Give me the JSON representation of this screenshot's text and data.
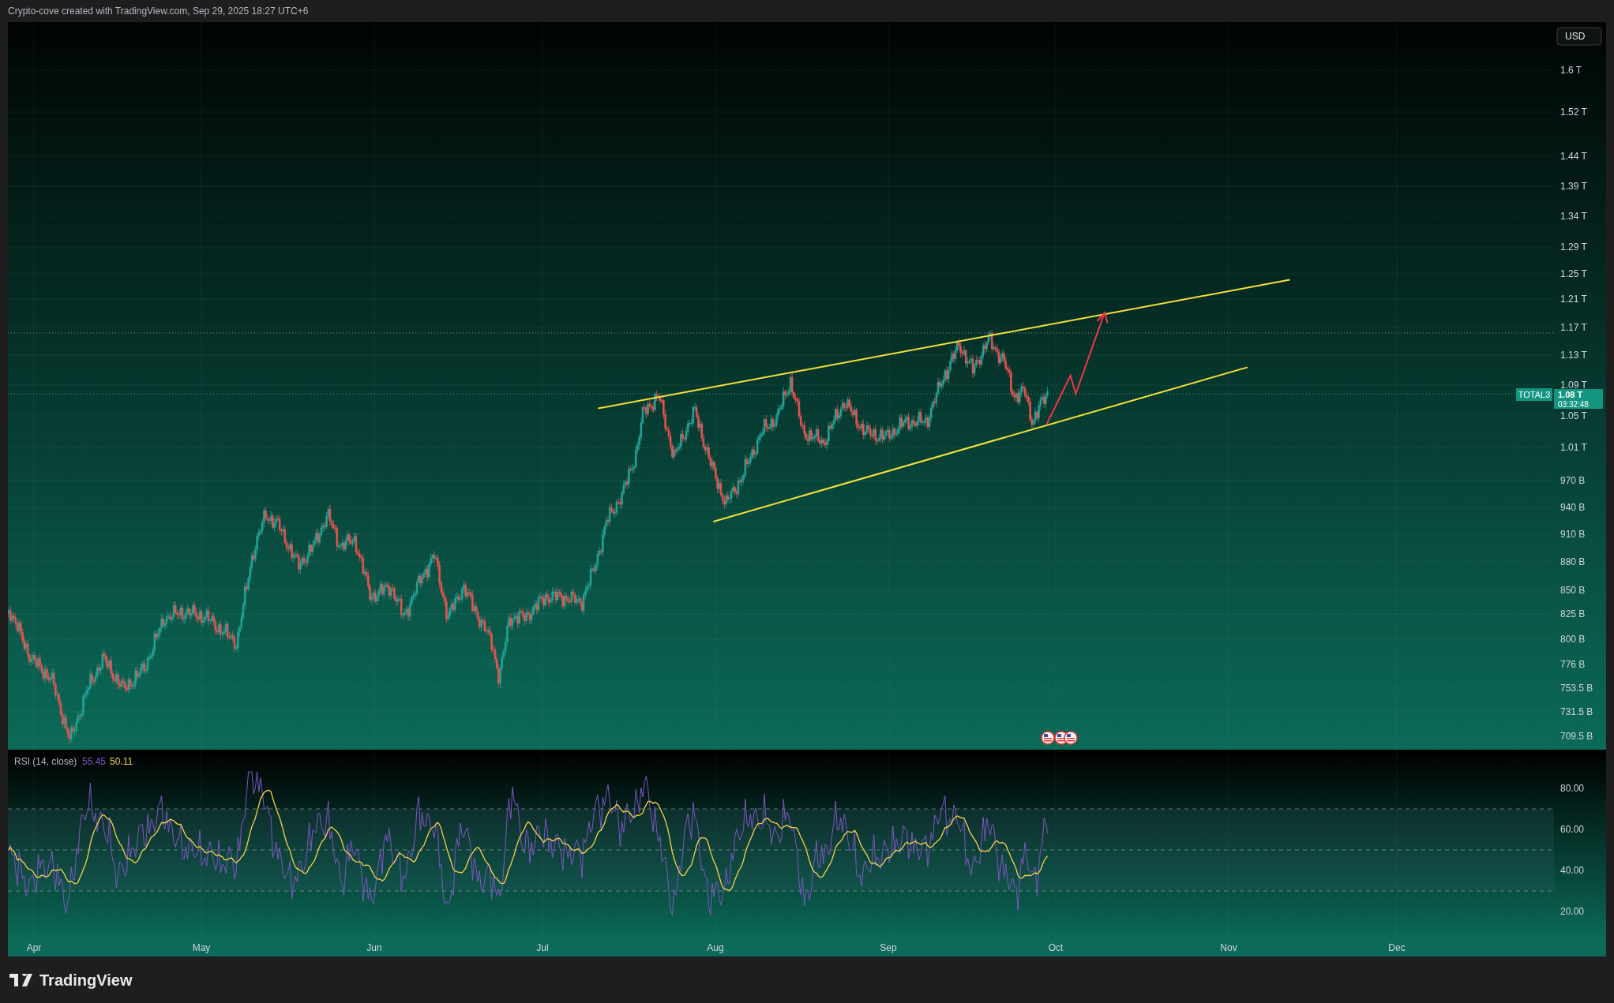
{
  "header": {
    "text": "Crypto-cove created with TradingView.com, Sep 29, 2025 18:27 UTC+6"
  },
  "price_axis": {
    "currency_button": "USD",
    "labels": [
      "1.6 T",
      "1.52 T",
      "1.44 T",
      "1.39 T",
      "1.34 T",
      "1.29 T",
      "1.25 T",
      "1.21 T",
      "1.17 T",
      "1.13 T",
      "1.09 T",
      "1.05 T",
      "1.01 T",
      "970 B",
      "940 B",
      "910 B",
      "880 B",
      "850 B",
      "825 B",
      "800 B",
      "776 B",
      "753.5 B",
      "731.5 B",
      "709.5 B"
    ]
  },
  "symbol_label": {
    "symbol": "TOTAL3",
    "price": "1.08 T",
    "countdown": "03:32:48"
  },
  "rsi": {
    "title": "RSI (14, close)",
    "values": [
      {
        "text": "55.45",
        "color": "#7e57c2"
      },
      {
        "text": "50.11",
        "color": "#f7d34b"
      }
    ],
    "axis_labels": [
      "80.00",
      "60.00",
      "40.00",
      "20.00"
    ]
  },
  "time_axis": {
    "labels": [
      "Apr",
      "May",
      "Jun",
      "Jul",
      "Aug",
      "Sep",
      "Oct",
      "Nov",
      "Dec"
    ]
  },
  "footer": {
    "brand": "TradingView"
  }
}
